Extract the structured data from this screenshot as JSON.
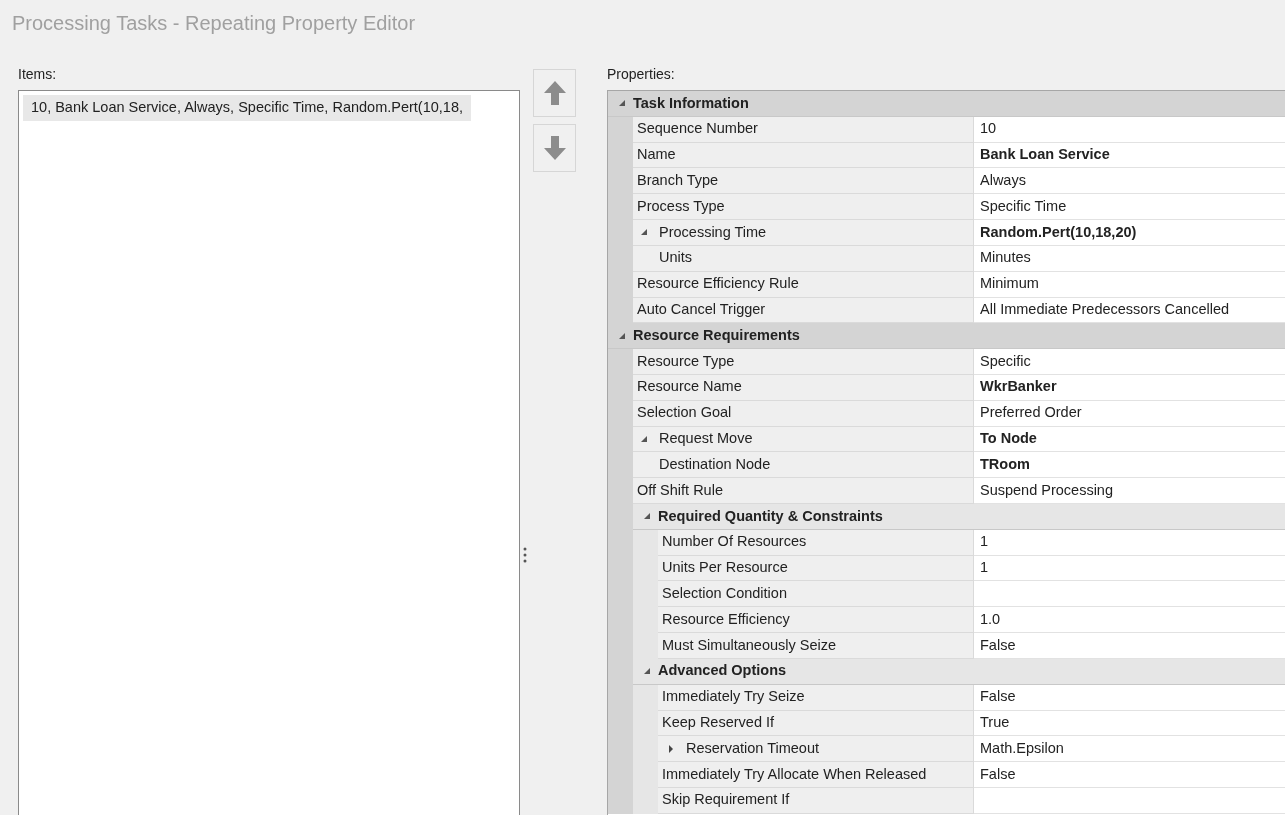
{
  "window": {
    "title": "Processing Tasks - Repeating Property Editor"
  },
  "items": {
    "label": "Items:",
    "entries": [
      {
        "text": "10, Bank Loan Service, Always, Specific Time, Random.Pert(10,18,",
        "selected": true
      }
    ]
  },
  "properties": {
    "label": "Properties:",
    "categories": [
      {
        "title": "Task Information",
        "expanded": true,
        "rows": [
          {
            "kind": "property",
            "name": "Sequence Number",
            "value": "10",
            "modified": false
          },
          {
            "kind": "property",
            "name": "Name",
            "value": "Bank Loan Service",
            "modified": true
          },
          {
            "kind": "property",
            "name": "Branch Type",
            "value": "Always",
            "modified": false
          },
          {
            "kind": "property",
            "name": "Process Type",
            "value": "Specific Time",
            "modified": false
          },
          {
            "kind": "property",
            "name": "Processing Time",
            "value": "Random.Pert(10,18,20)",
            "modified": true,
            "expanded": true,
            "children": [
              {
                "kind": "property",
                "name": "Units",
                "value": "Minutes",
                "modified": false
              }
            ]
          },
          {
            "kind": "property",
            "name": "Resource Efficiency Rule",
            "value": "Minimum",
            "modified": false
          },
          {
            "kind": "property",
            "name": "Auto Cancel Trigger",
            "value": "All Immediate Predecessors Cancelled",
            "modified": false
          }
        ]
      },
      {
        "title": "Resource Requirements",
        "expanded": true,
        "rows": [
          {
            "kind": "property",
            "name": "Resource Type",
            "value": "Specific",
            "modified": false
          },
          {
            "kind": "property",
            "name": "Resource Name",
            "value": "WkrBanker",
            "modified": true
          },
          {
            "kind": "property",
            "name": "Selection Goal",
            "value": "Preferred Order",
            "modified": false
          },
          {
            "kind": "property",
            "name": "Request Move",
            "value": "To Node",
            "modified": true,
            "expanded": true,
            "children": [
              {
                "kind": "property",
                "name": "Destination Node",
                "value": "TRoom",
                "modified": true
              }
            ]
          },
          {
            "kind": "property",
            "name": "Off Shift Rule",
            "value": "Suspend Processing",
            "modified": false
          },
          {
            "kind": "category",
            "title": "Required Quantity & Constraints",
            "expanded": true,
            "rows": [
              {
                "kind": "property",
                "name": "Number Of Resources",
                "value": "1",
                "modified": false
              },
              {
                "kind": "property",
                "name": "Units Per Resource",
                "value": "1",
                "modified": false
              },
              {
                "kind": "property",
                "name": "Selection Condition",
                "modified": false
              },
              {
                "kind": "property",
                "name": "Resource Efficiency",
                "value": "1.0",
                "modified": false
              },
              {
                "kind": "property",
                "name": "Must Simultaneously Seize",
                "value": "False",
                "modified": false
              }
            ]
          },
          {
            "kind": "category",
            "title": "Advanced Options",
            "expanded": true,
            "rows": [
              {
                "kind": "property",
                "name": "Immediately Try Seize",
                "value": "False",
                "modified": false
              },
              {
                "kind": "property",
                "name": "Keep Reserved If",
                "value": "True",
                "modified": false
              },
              {
                "kind": "property",
                "name": "Reservation Timeout",
                "value": "Math.Epsilon",
                "modified": false,
                "expanded": false
              },
              {
                "kind": "property",
                "name": "Immediately Try Allocate When Released",
                "value": "False",
                "modified": false
              },
              {
                "kind": "property",
                "name": "Skip Requirement If",
                "modified": false
              }
            ]
          }
        ]
      }
    ]
  }
}
